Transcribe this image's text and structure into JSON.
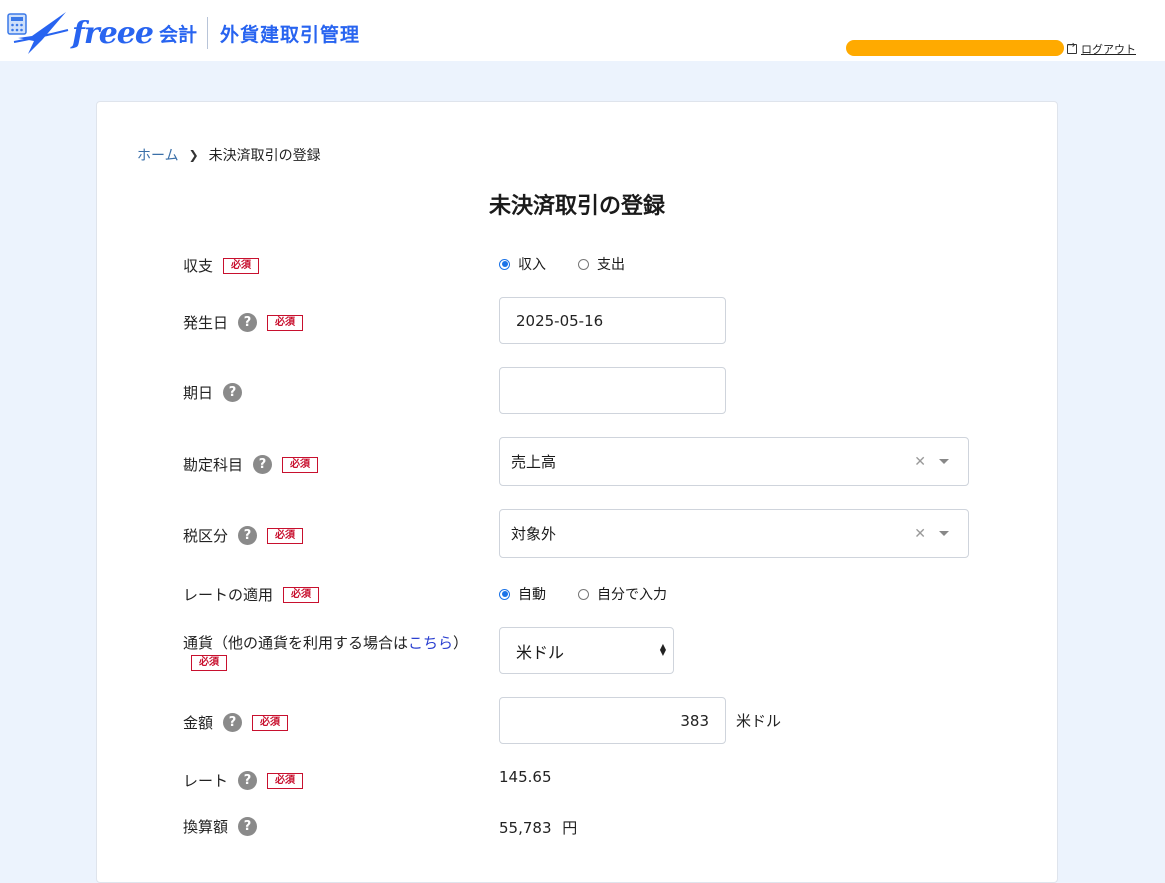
{
  "header": {
    "logo_word": "freee",
    "logo_kaikei": "会計",
    "app_name": "外貨建取引管理",
    "logout_label": "ログアウト",
    "user_bar_color": "#ffaa00"
  },
  "breadcrumb": {
    "home": "ホーム",
    "current": "未決済取引の登録"
  },
  "page_title": "未決済取引の登録",
  "labels": {
    "required": "必須",
    "help": "?"
  },
  "form": {
    "income_expense": {
      "label": "収支",
      "options": [
        "収入",
        "支出"
      ],
      "selected": "収入"
    },
    "occurrence_date": {
      "label": "発生日",
      "value": "2025-05-16"
    },
    "due_date": {
      "label": "期日",
      "value": ""
    },
    "account": {
      "label": "勘定科目",
      "value": "売上高"
    },
    "tax_category": {
      "label": "税区分",
      "value": "対象外"
    },
    "rate_application": {
      "label": "レートの適用",
      "options": [
        "自動",
        "自分で入力"
      ],
      "selected": "自動"
    },
    "currency": {
      "label_prefix": "通貨（他の通貨を利用する場合は",
      "label_link": "こちら",
      "label_suffix": "）",
      "value": "米ドル"
    },
    "amount": {
      "label": "金額",
      "value": "383",
      "unit": "米ドル"
    },
    "rate": {
      "label": "レート",
      "value": "145.65"
    },
    "converted_amount": {
      "label": "換算額",
      "value": "55,783",
      "unit": "円"
    }
  }
}
